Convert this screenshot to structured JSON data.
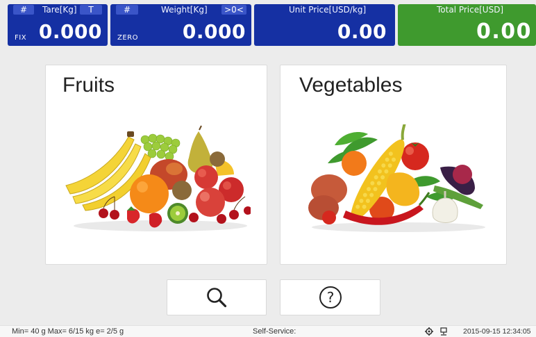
{
  "display": {
    "tare": {
      "hash": "#",
      "label": "Tare[Kg]",
      "key": "T",
      "tag": "FIX",
      "value": "0.000"
    },
    "weight": {
      "hash": "#",
      "label": "Weight[Kg]",
      "key": ">0<",
      "tag": "ZERO",
      "value": "0.000"
    },
    "unit_price": {
      "label": "Unit Price[USD/kg]",
      "value": "0.00"
    },
    "total_price": {
      "label": "Total Price[USD]",
      "value": "0.00"
    },
    "colors": {
      "panel_blue": "#1530a3",
      "panel_green": "#3f9a2e"
    }
  },
  "categories": [
    {
      "name": "Fruits",
      "icon": "fruit-basket-image"
    },
    {
      "name": "Vegetables",
      "icon": "vegetable-basket-image"
    }
  ],
  "actions": {
    "search_icon": "search-icon",
    "help_icon": "help-icon",
    "help_glyph": "?"
  },
  "status": {
    "scale_info": "Min= 40 g  Max= 6/15 kg  e= 2/5 g",
    "mode": "Self-Service:",
    "datetime": "2015-09-15  12:34:05"
  }
}
